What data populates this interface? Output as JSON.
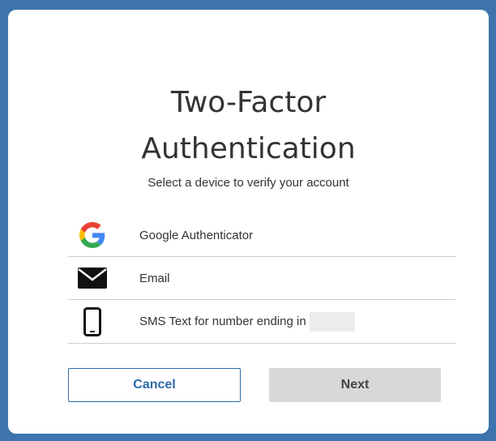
{
  "dialog": {
    "title": "Two-Factor Authentication",
    "title_line1": "Two-Factor",
    "title_line2": "Authentication",
    "subtitle": "Select a device to verify your account"
  },
  "options": [
    {
      "label": "Google Authenticator",
      "icon": "google-icon"
    },
    {
      "label": "Email",
      "icon": "envelope-icon"
    },
    {
      "label": "SMS Text for number ending in",
      "icon": "mobile-phone-icon"
    }
  ],
  "buttons": {
    "cancel": "Cancel",
    "next": "Next"
  },
  "colors": {
    "background": "#3d74ad",
    "accent": "#2b6aa8",
    "disabled_button": "#d8d8d8"
  }
}
